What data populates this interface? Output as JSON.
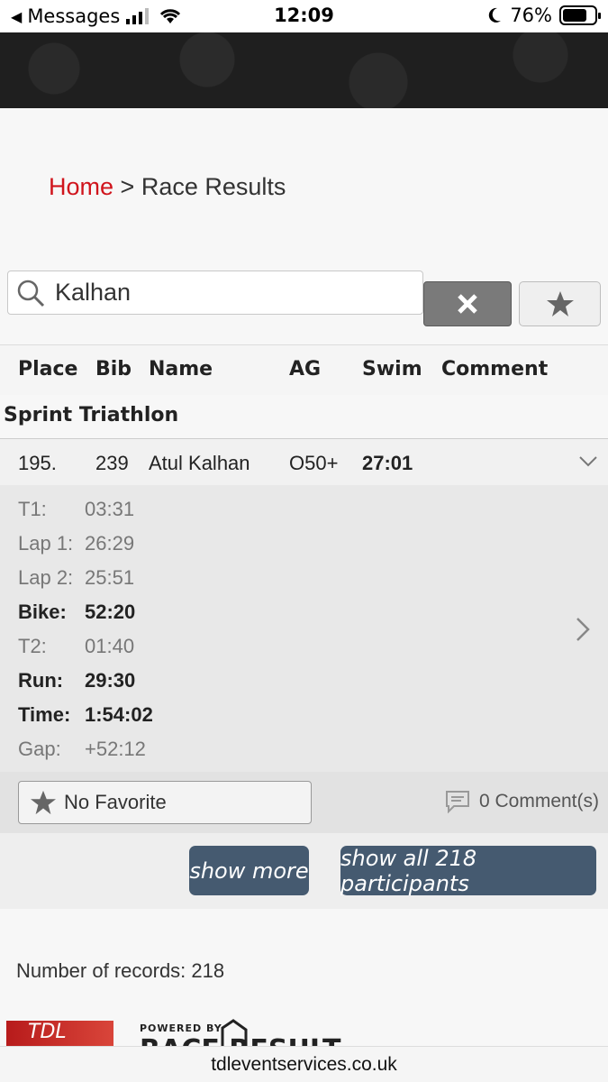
{
  "status_bar": {
    "back_app": "Messages",
    "time": "12:09",
    "battery": "76%",
    "battery_level": 0.76
  },
  "breadcrumb": {
    "home": "Home",
    "separator": ">",
    "current": "Race Results"
  },
  "search": {
    "value": "Kalhan"
  },
  "table": {
    "headers": [
      "Place",
      "Bib",
      "Name",
      "AG",
      "Swim",
      "Comment"
    ],
    "group": "Sprint Triathlon",
    "row": {
      "place": "195.",
      "bib": "239",
      "name": "Atul Kalhan",
      "ag": "O50+",
      "swim": "27:01"
    },
    "details": [
      {
        "label": "T1:",
        "value": "03:31",
        "bold": false
      },
      {
        "label": "Lap 1:",
        "value": "26:29",
        "bold": false
      },
      {
        "label": "Lap 2:",
        "value": "25:51",
        "bold": false
      },
      {
        "label": "Bike:",
        "value": "52:20",
        "bold": true
      },
      {
        "label": "T2:",
        "value": "01:40",
        "bold": false
      },
      {
        "label": "Run:",
        "value": "29:30",
        "bold": true
      },
      {
        "label": "Time:",
        "value": "1:54:02",
        "bold": true
      },
      {
        "label": "Gap:",
        "value": "+52:12",
        "bold": false
      }
    ]
  },
  "actions": {
    "favorite_label": "No Favorite",
    "comments_label": "0 Comment(s)"
  },
  "buttons": {
    "show_more": "show more",
    "show_all": "show all 218 participants"
  },
  "footer": {
    "records": "Number of records: 218",
    "powered_by": "POWERED BY",
    "tdl_logo_text": "TDL",
    "rr_logo_text": "RACE RESULT"
  },
  "url_bar": {
    "domain": "tdleventservices.co.uk"
  }
}
